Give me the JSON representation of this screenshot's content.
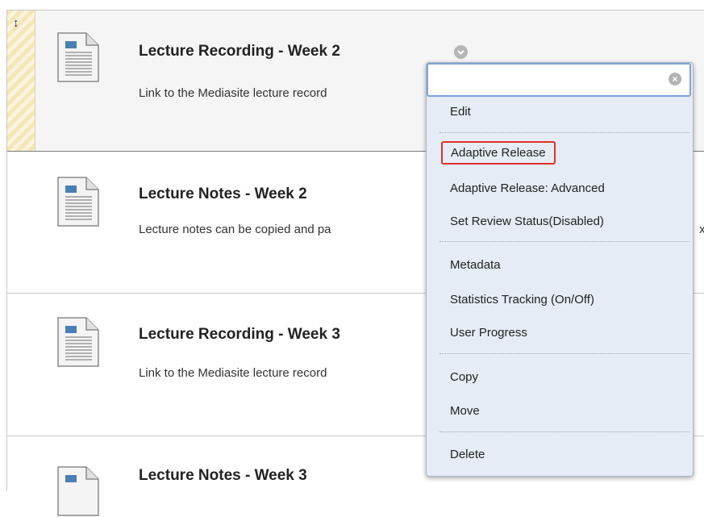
{
  "items": [
    {
      "title": "Lecture Recording - Week 2",
      "description": "Link to the Mediasite lecture record"
    },
    {
      "title": "Lecture Notes - Week 2",
      "description": "Lecture notes can be copied and pa"
    },
    {
      "title": "Lecture Recording - Week 3",
      "description": "Link to the Mediasite lecture record"
    },
    {
      "title": "Lecture Notes - Week 3",
      "description": ""
    }
  ],
  "clipped_char": "x",
  "icons": {
    "drag": "↕",
    "close": "×"
  },
  "menu": {
    "items": [
      {
        "label": "Edit"
      },
      {
        "label": "Adaptive Release",
        "highlighted": true
      },
      {
        "label": "Adaptive Release: Advanced"
      },
      {
        "label": "Set Review Status(Disabled)"
      },
      {
        "label": "Metadata"
      },
      {
        "label": "Statistics Tracking (On/Off)"
      },
      {
        "label": "User Progress"
      },
      {
        "label": "Copy"
      },
      {
        "label": "Move"
      },
      {
        "label": "Delete"
      }
    ]
  },
  "colors": {
    "highlight_border": "#e0302a",
    "menu_bg": "#e5ecf6",
    "focus_border": "#7fa4d6"
  }
}
